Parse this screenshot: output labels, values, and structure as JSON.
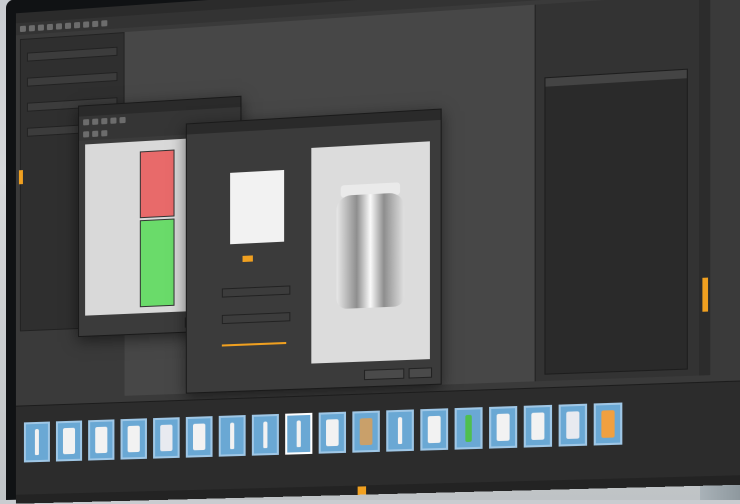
{
  "app": {
    "title_label": "",
    "menu_selected": ""
  },
  "colors": {
    "accent": "#f0a020",
    "uv_red": "#e86a6a",
    "uv_green": "#6adb6a",
    "thumb_border": "#9fc7e6"
  },
  "left_panel": {
    "rows": [
      "",
      "",
      "",
      "",
      ""
    ]
  },
  "uv_window": {
    "title": "",
    "buttons": [
      "",
      ""
    ]
  },
  "preview_window": {
    "title": "",
    "section_label": "",
    "buttons": [
      "",
      ""
    ]
  },
  "right_panel": {
    "title": ""
  },
  "shelf": {
    "label": "",
    "items": [
      {
        "icon": "bottle-icon",
        "label": ""
      },
      {
        "icon": "box-icon",
        "label": ""
      },
      {
        "icon": "box-icon",
        "label": ""
      },
      {
        "icon": "box-icon",
        "label": ""
      },
      {
        "icon": "pouch-icon",
        "label": ""
      },
      {
        "icon": "box-icon",
        "label": ""
      },
      {
        "icon": "bottle-icon",
        "label": ""
      },
      {
        "icon": "jar-icon",
        "label": ""
      },
      {
        "icon": "bottle-icon",
        "label": ""
      },
      {
        "icon": "box-icon",
        "label": ""
      },
      {
        "icon": "cardboard-box-icon",
        "label": ""
      },
      {
        "icon": "bottle-icon",
        "label": ""
      },
      {
        "icon": "box-icon",
        "label": ""
      },
      {
        "icon": "green-bottle-icon",
        "label": ""
      },
      {
        "icon": "box-icon",
        "label": ""
      },
      {
        "icon": "box-icon",
        "label": ""
      },
      {
        "icon": "bag-icon",
        "label": ""
      },
      {
        "icon": "crate-icon",
        "label": ""
      }
    ]
  },
  "status": {
    "active_tab": "",
    "tabs": [
      "",
      ""
    ]
  }
}
